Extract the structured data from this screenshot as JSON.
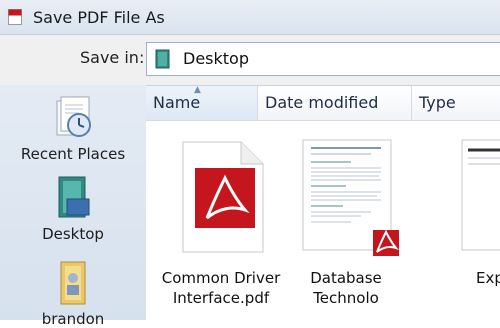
{
  "window": {
    "title": "Save PDF File As"
  },
  "toolbar": {
    "save_in_label": "Save in:",
    "location": "Desktop"
  },
  "places": [
    {
      "label": "Recent Places",
      "icon": "recent-places-icon"
    },
    {
      "label": "Desktop",
      "icon": "desktop-icon"
    },
    {
      "label": "brandon",
      "icon": "user-folder-icon"
    }
  ],
  "columns": {
    "name": "Name",
    "date_modified": "Date modified",
    "type": "Type",
    "sort": "ascending"
  },
  "files": [
    {
      "line1": "Common Driver",
      "line2": "Interface.pdf",
      "icon": "pdf-file-icon"
    },
    {
      "line1": "Database",
      "line2": "Technolo",
      "icon": "pdf-document-thumbnail"
    },
    {
      "line1": "Exp",
      "line2": "",
      "icon": "document-thumbnail"
    }
  ],
  "colors": {
    "pdf_red": "#c4161c",
    "title_bar": "#dde6f1",
    "places_bar": "#dce5f0",
    "header_text": "#1e2e45"
  }
}
